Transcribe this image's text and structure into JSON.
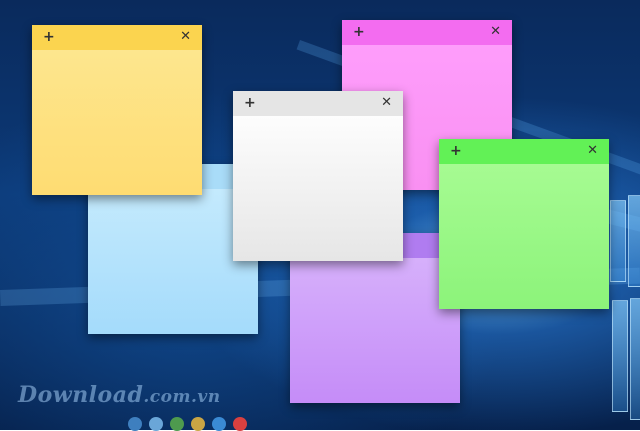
{
  "notes": [
    {
      "id": "yellow",
      "plus": "+",
      "close": "✕",
      "bar": "#fbd44f",
      "top": "#fde68e",
      "bottom": "#fedc72"
    },
    {
      "id": "blue",
      "plus": "+",
      "close": "✕",
      "bar": "#a9dcf8",
      "top": "#c4eafd",
      "bottom": "#a4dbfb"
    },
    {
      "id": "pink",
      "plus": "+",
      "close": "✕",
      "bar": "#f36cf0",
      "top": "#fe9dfb",
      "bottom": "#f990f2"
    },
    {
      "id": "white",
      "plus": "+",
      "close": "✕",
      "bar": "#e5e5e5",
      "top": "#fdfdfd",
      "bottom": "#e6e6e6"
    },
    {
      "id": "purple",
      "plus": "+",
      "close": "✕",
      "bar": "#b07cf0",
      "top": "#d6b0fb",
      "bottom": "#c58cf8"
    },
    {
      "id": "green",
      "plus": "+",
      "close": "✕",
      "bar": "#62f156",
      "top": "#a6fb92",
      "bottom": "#8cf37a"
    }
  ],
  "watermark": {
    "main": "Download",
    "suffix": ".com.vn"
  },
  "watermark_dots": [
    "#3e7fbf",
    "#6aa6d8",
    "#4e9a4e",
    "#c9a544",
    "#3a8ad4",
    "#d84040"
  ]
}
